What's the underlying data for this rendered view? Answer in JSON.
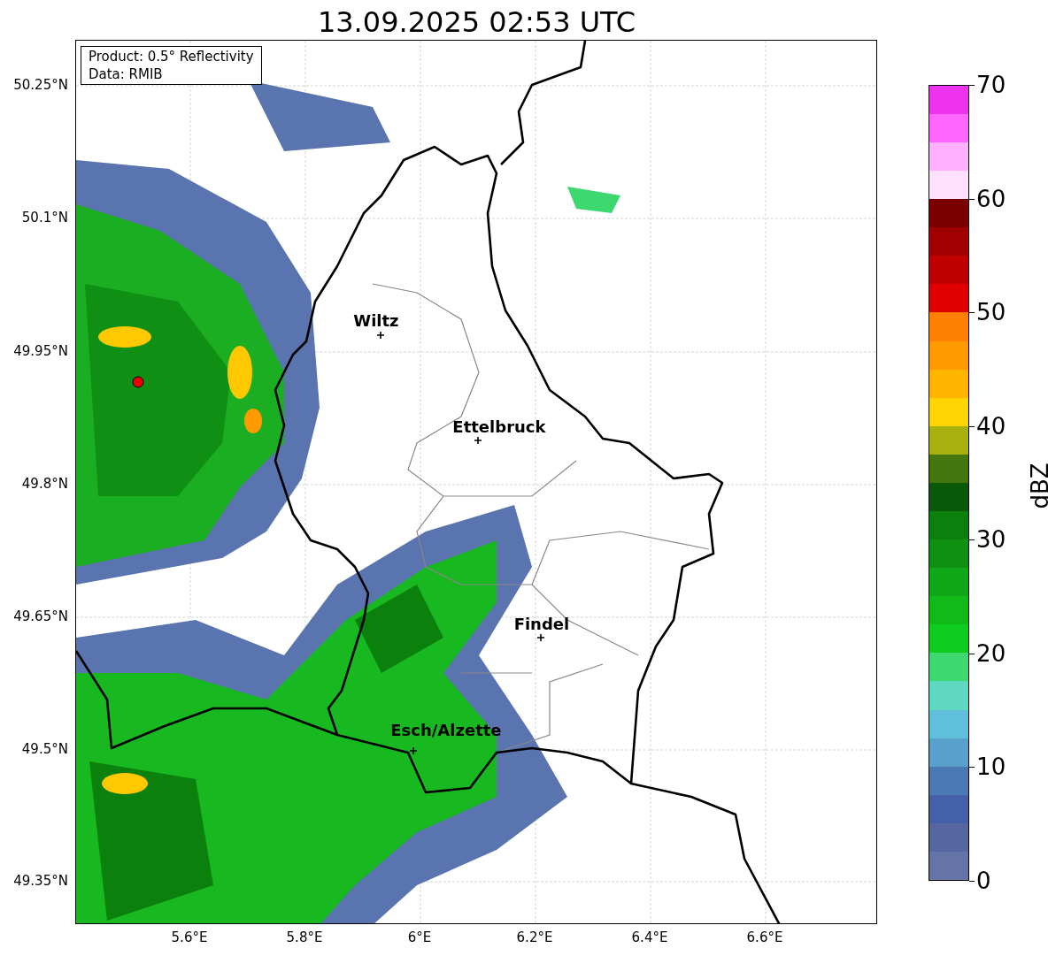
{
  "title": "13.09.2025 02:53 UTC",
  "legend": [
    "Product: 0.5° Reflectivity",
    "Data: RMIB"
  ],
  "cities": [
    {
      "name": "Wiltz"
    },
    {
      "name": "Ettelbruck"
    },
    {
      "name": "Findel"
    },
    {
      "name": "Esch/Alzette"
    }
  ],
  "lat_ticks": [
    "50.25°N",
    "50.1°N",
    "49.95°N",
    "49.8°N",
    "49.65°N",
    "49.5°N",
    "49.35°N"
  ],
  "lon_ticks": [
    "5.6°E",
    "5.8°E",
    "6°E",
    "6.2°E",
    "6.4°E",
    "6.6°E"
  ],
  "colorbar": {
    "label": "dBZ",
    "ticks": [
      "70",
      "60",
      "50",
      "40",
      "30",
      "20",
      "10",
      "0"
    ],
    "bins": [
      {
        "color": "#6474a8"
      },
      {
        "color": "#5566a0"
      },
      {
        "color": "#4460a8"
      },
      {
        "color": "#4a7ab5"
      },
      {
        "color": "#5aa0cc"
      },
      {
        "color": "#60c0dc"
      },
      {
        "color": "#5ed8c0"
      },
      {
        "color": "#3dd870"
      },
      {
        "color": "#10cc20"
      },
      {
        "color": "#10bb18"
      },
      {
        "color": "#10a818"
      },
      {
        "color": "#109010"
      },
      {
        "color": "#0c800c"
      },
      {
        "color": "#0a5a0a"
      },
      {
        "color": "#46760e"
      },
      {
        "color": "#aab010"
      },
      {
        "color": "#ffd400"
      },
      {
        "color": "#ffb400"
      },
      {
        "color": "#ff9a00"
      },
      {
        "color": "#ff7f00"
      },
      {
        "color": "#e00000"
      },
      {
        "color": "#c00000"
      },
      {
        "color": "#a00000"
      },
      {
        "color": "#7a0000"
      },
      {
        "color": "#ffe0ff"
      },
      {
        "color": "#ffb0ff"
      },
      {
        "color": "#ff66ff"
      },
      {
        "color": "#ee33ee"
      }
    ]
  }
}
